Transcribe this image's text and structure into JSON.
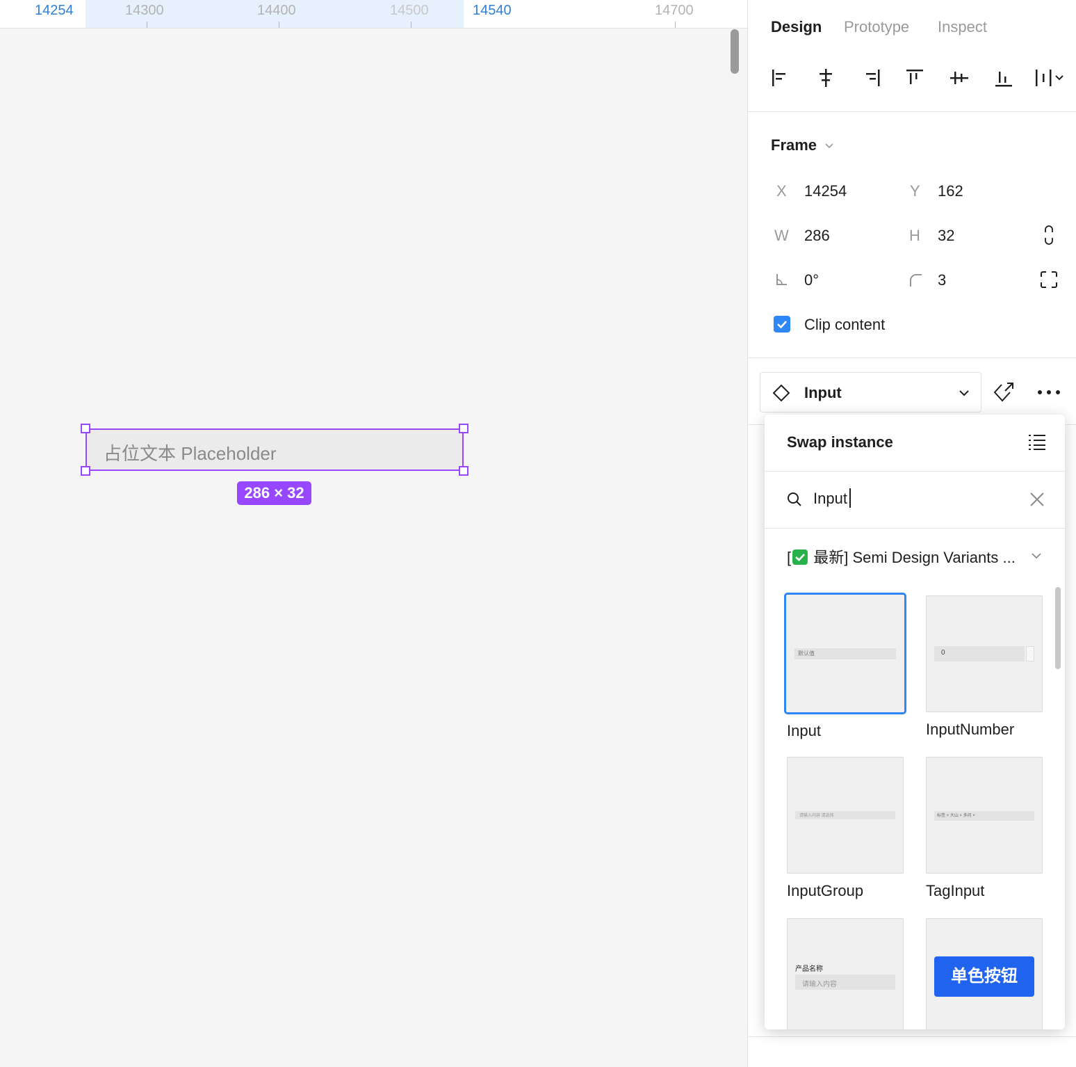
{
  "ruler": {
    "labels": [
      "14254",
      "14300",
      "14400",
      "14500",
      "14540",
      "14700"
    ]
  },
  "canvas": {
    "placeholder": "占位文本 Placeholder",
    "size_badge": "286 × 32"
  },
  "panel": {
    "tabs": [
      "Design",
      "Prototype",
      "Inspect"
    ],
    "frame": {
      "title": "Frame",
      "x_label": "X",
      "x": "14254",
      "y_label": "Y",
      "y": "162",
      "w_label": "W",
      "w": "286",
      "h_label": "H",
      "h": "32",
      "rotation": "0°",
      "radius": "3",
      "clip_label": "Clip content",
      "clip_checked": true
    },
    "instance": {
      "name": "Input"
    }
  },
  "swap": {
    "title": "Swap instance",
    "search_value": "Input",
    "library": "[✅ 最新] Semi Design Variants ...",
    "library_text": "最新] Semi Design Variants ...",
    "components": [
      {
        "name": "Input",
        "preview": "默认值",
        "selected": true
      },
      {
        "name": "InputNumber",
        "preview": "0",
        "selected": false
      },
      {
        "name": "InputGroup",
        "preview": "请输入内容 请选择",
        "selected": false
      },
      {
        "name": "TagInput",
        "preview": "标签 × 大山 × 多问 ×",
        "selected": false
      },
      {
        "name": "",
        "preview_label": "产品名称",
        "preview": "请输入内容"
      },
      {
        "name": "",
        "preview": "单色按钮"
      }
    ]
  },
  "colors": {
    "selection": "#9747ff",
    "accent": "#2f86f6",
    "button_blue": "#1f63ef"
  }
}
